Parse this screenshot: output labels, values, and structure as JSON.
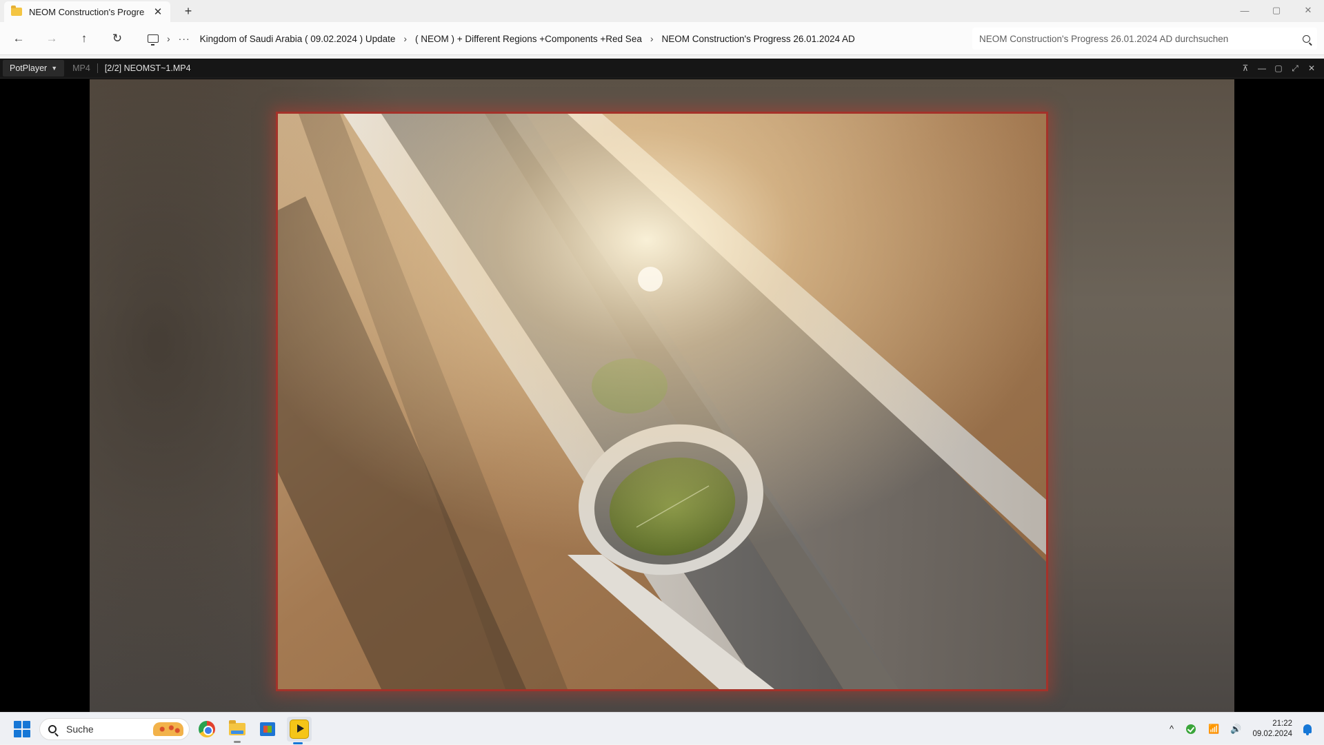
{
  "window": {
    "tab_title": "NEOM Construction's Progress",
    "tab_close": "✕",
    "new_tab": "+",
    "controls": {
      "minimize": "—",
      "maximize": "▢",
      "close": "✕"
    }
  },
  "explorer": {
    "nav": {
      "back": "←",
      "forward": "→",
      "up": "↑",
      "refresh": "↻"
    },
    "breadcrumb_more": "···",
    "breadcrumbs": [
      "Kingdom of Saudi Arabia ( 09.02.2024 ) Update",
      "( NEOM ) + Different Regions +Components +Red Sea",
      "NEOM Construction's Progress 26.01.2024 AD"
    ],
    "search_placeholder": "NEOM Construction's Progress 26.01.2024 AD durchsuchen"
  },
  "player": {
    "menu_label": "PotPlayer",
    "format": "MP4",
    "file_label": "[2/2] NEOMST~1.MP4",
    "controls": {
      "pin": "⊼",
      "minimize": "—",
      "maximize": "▢",
      "fullscreen": "⤢",
      "close": "✕"
    },
    "frame_border_color": "#a4322a"
  },
  "taskbar": {
    "search_label": "Suche",
    "apps": [
      "chrome-icon",
      "file-explorer-icon",
      "store-icon",
      "potplayer-icon"
    ],
    "tray": {
      "chevron": "^",
      "wifi": "📶",
      "volume": "🔊"
    },
    "time": "21:22",
    "date": "09.02.2024",
    "accent": "#1677d6"
  }
}
